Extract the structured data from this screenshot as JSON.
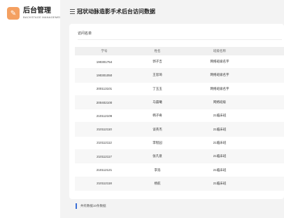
{
  "brand": {
    "title": "后台管理",
    "subtitle": "BACKSTAGE MANAGEMENT",
    "icon": "wrench-icon",
    "color": "#f4a061"
  },
  "header": {
    "menu_icon": "menu-icon",
    "title": "冠状动脉造影手术后台访问数据"
  },
  "card": {
    "title": "访问名单"
  },
  "table": {
    "columns": [
      "学号",
      "姓名",
      "班级名称"
    ],
    "rows": [
      [
        "190301754",
        "郭子吉",
        "网络班级名字"
      ],
      [
        "190301050",
        "王思琦",
        "网络班级名字"
      ],
      [
        "200113101",
        "丁玉玉",
        "网络班级名字"
      ],
      [
        "200402100",
        "马晨曦",
        "网络班级"
      ],
      [
        "210112109",
        "韩子奇",
        "21临床班"
      ],
      [
        "210112110",
        "谈英杰",
        "21临床班"
      ],
      [
        "210112112",
        "李程园",
        "21临床班"
      ],
      [
        "210112117",
        "张凡意",
        "21临床班"
      ],
      [
        "210112121",
        "李浩",
        "21临床班"
      ],
      [
        "210112118",
        "杨航",
        "21临床班"
      ]
    ]
  },
  "footer": {
    "text": "共有数据10条数据",
    "accent": "#3b6fd6"
  }
}
